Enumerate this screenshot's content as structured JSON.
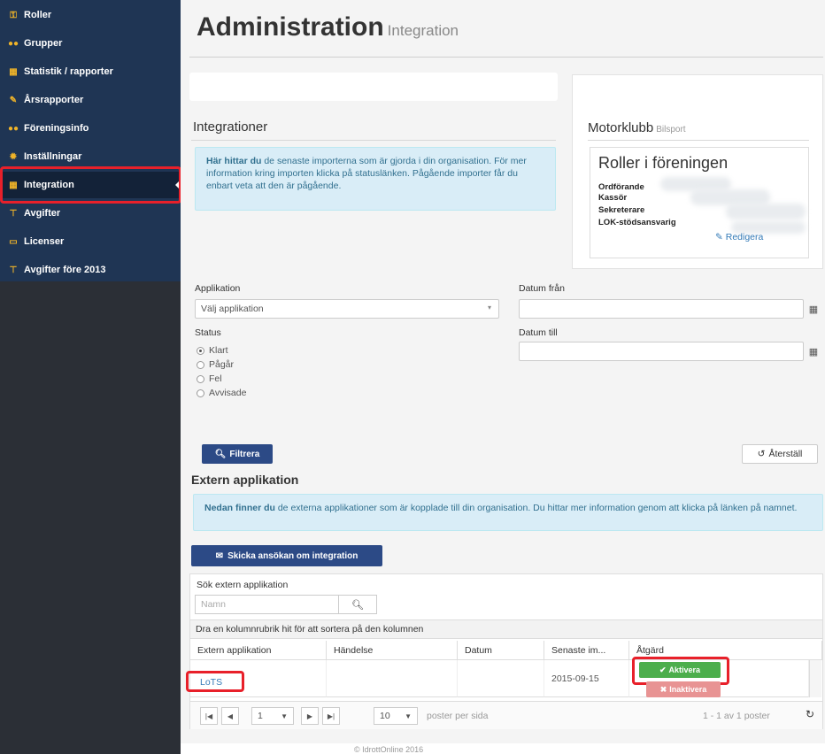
{
  "sidebar": {
    "items": [
      {
        "label": "Roller",
        "icon": "key-icon"
      },
      {
        "label": "Grupper",
        "icon": "users-icon"
      },
      {
        "label": "Statistik / rapporter",
        "icon": "chart-icon"
      },
      {
        "label": "Årsrapporter",
        "icon": "pencil-icon"
      },
      {
        "label": "Föreningsinfo",
        "icon": "users-icon"
      },
      {
        "label": "Inställningar",
        "icon": "gear-icon"
      },
      {
        "label": "Integration",
        "icon": "grid-icon"
      },
      {
        "label": "Avgifter",
        "icon": "cart-icon"
      },
      {
        "label": "Licenser",
        "icon": "card-icon"
      },
      {
        "label": "Avgifter före 2013",
        "icon": "cart-icon"
      }
    ],
    "active_index": 6
  },
  "header": {
    "title": "Administration",
    "subtitle": "Integration"
  },
  "integrationer": {
    "title": "Integrationer",
    "info_bold": "Här hittar du",
    "info_text": "de senaste importerna som är gjorda i din organisation. För mer information kring importen klicka på statuslänken. Pågående importer får du enbart veta att den är pågående."
  },
  "motorklubb": {
    "title": "Motorklubb",
    "subtitle": "Bilsport",
    "roles_title": "Roller i föreningen",
    "roles": [
      "Ordförande",
      "Kassör",
      "Sekreterare",
      "LOK-stödsansvarig"
    ],
    "edit_label": "Redigera"
  },
  "filter": {
    "applikation_label": "Applikation",
    "applikation_value": "Välj applikation",
    "status_label": "Status",
    "status_options": [
      "Klart",
      "Pågår",
      "Fel",
      "Avvisade"
    ],
    "status_selected": 0,
    "datum_fran_label": "Datum från",
    "datum_till_label": "Datum till",
    "filter_button": "Filtrera",
    "reset_button": "Återställ"
  },
  "extern": {
    "title": "Extern applikation",
    "info_bold": "Nedan finner du",
    "info_text": "de externa applikationer som är kopplade till din organisation. Du hittar mer information genom att klicka på länken på namnet.",
    "send_button": "Skicka ansökan om integration"
  },
  "grid": {
    "search_label": "Sök extern applikation",
    "search_placeholder": "Namn",
    "group_hint": "Dra en kolumnrubrik hit för att sortera på den kolumnen",
    "columns": [
      "Extern applikation",
      "Händelse",
      "Datum",
      "Senaste im...",
      "Åtgärd"
    ],
    "rows": [
      {
        "name": "LoTS",
        "handelse": "",
        "datum": "",
        "senaste": "2015-09-15",
        "activate": "Aktivera",
        "deactivate": "Inaktivera"
      }
    ],
    "pager": {
      "page": "1",
      "page_size": "10",
      "per_page_label": "poster per sida",
      "summary": "1 - 1 av 1 poster"
    }
  },
  "footer": {
    "text": "© IdrottOnline 2016"
  },
  "colors": {
    "sidebar_panel": "#1f3554",
    "primary": "#2c4a86",
    "success": "#4cae4c",
    "danger": "#e89393",
    "highlight": "#e8202a",
    "info_bg": "#d9edf7"
  }
}
